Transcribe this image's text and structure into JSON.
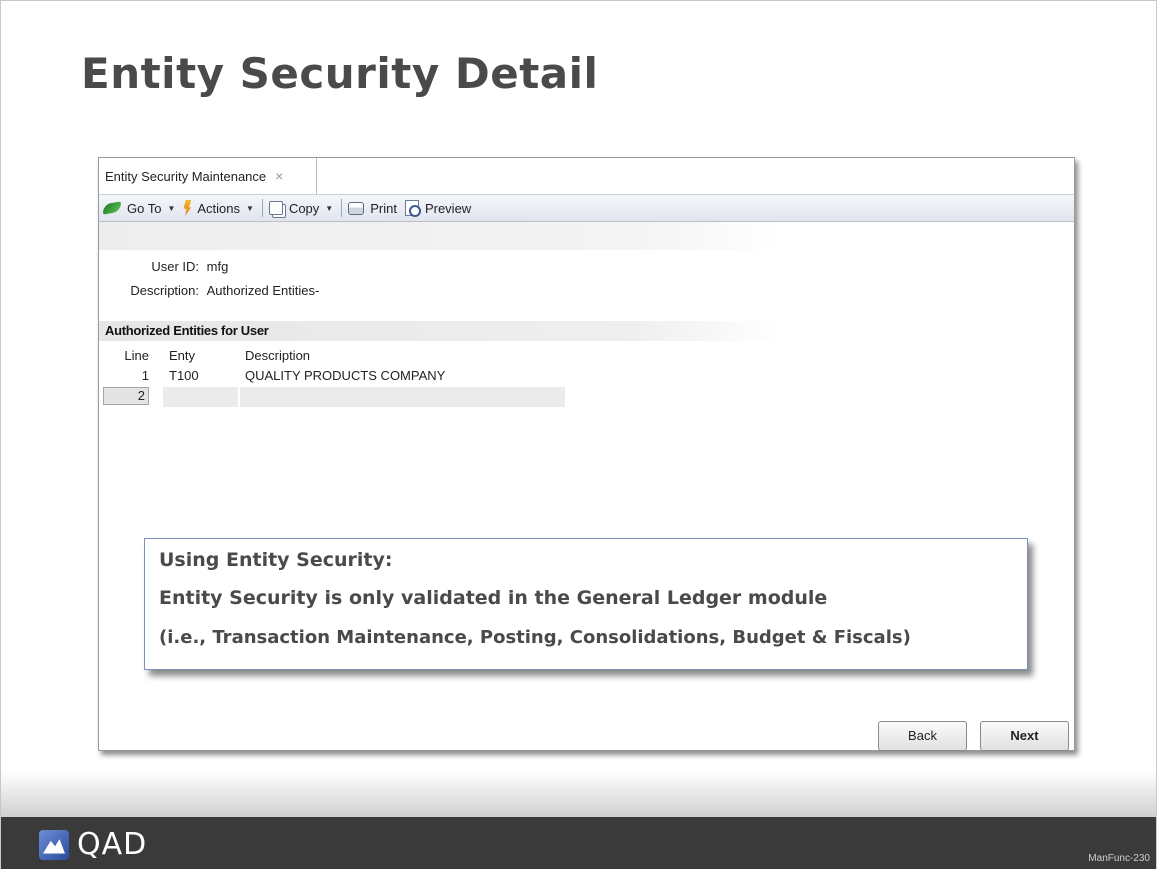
{
  "slide": {
    "title": "Entity Security Detail",
    "footer_logo": "QAD",
    "slide_number": "ManFunc-230"
  },
  "window": {
    "tab": {
      "label": "Entity Security Maintenance",
      "close_glyph": "×"
    },
    "toolbar": [
      {
        "id": "goto",
        "label": "Go To",
        "icon": "goto-arrow-icon",
        "dropdown": true
      },
      {
        "id": "actions",
        "label": "Actions",
        "icon": "lightning-icon",
        "dropdown": true
      },
      {
        "id": "copy",
        "label": "Copy",
        "icon": "copy-icon",
        "dropdown": true
      },
      {
        "id": "print",
        "label": "Print",
        "icon": "printer-icon",
        "dropdown": false
      },
      {
        "id": "preview",
        "label": "Preview",
        "icon": "preview-icon",
        "dropdown": false
      }
    ],
    "fields": {
      "user_id": {
        "label": "User ID:",
        "value": "mfg"
      },
      "description": {
        "label": "Description:",
        "value": "Authorized Entities-"
      }
    },
    "section_title": "Authorized Entities for User",
    "grid": {
      "columns": [
        "Line",
        "Enty",
        "Description"
      ],
      "rows": [
        {
          "line": "1",
          "enty": "T100",
          "description": "QUALITY PRODUCTS COMPANY"
        }
      ],
      "new_row": {
        "line": "2",
        "enty": "",
        "description": ""
      }
    },
    "buttons": {
      "back": "Back",
      "next": "Next"
    }
  },
  "callout": {
    "heading": "Using Entity Security:",
    "line1": "Entity Security is only validated in the General Ledger module",
    "line2": "(i.e., Transaction Maintenance, Posting, Consolidations, Budget & Fiscals)"
  }
}
